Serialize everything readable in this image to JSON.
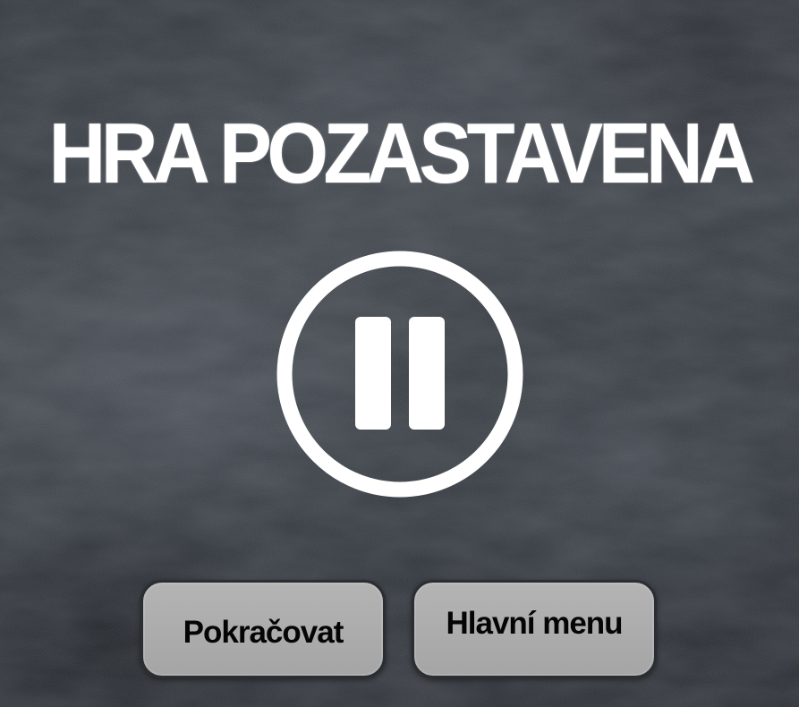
{
  "screen": {
    "title": "HRA POZASTAVENA",
    "pause_icon": "pause-circle-icon",
    "buttons": {
      "resume_label": "Pokračovat",
      "main_menu_label": "Hlavní menu"
    }
  },
  "colors": {
    "background": "#33383f",
    "text_primary": "#ffffff",
    "button_fill": "#ababab",
    "button_border": "#2a2d31",
    "button_text": "#050505"
  }
}
